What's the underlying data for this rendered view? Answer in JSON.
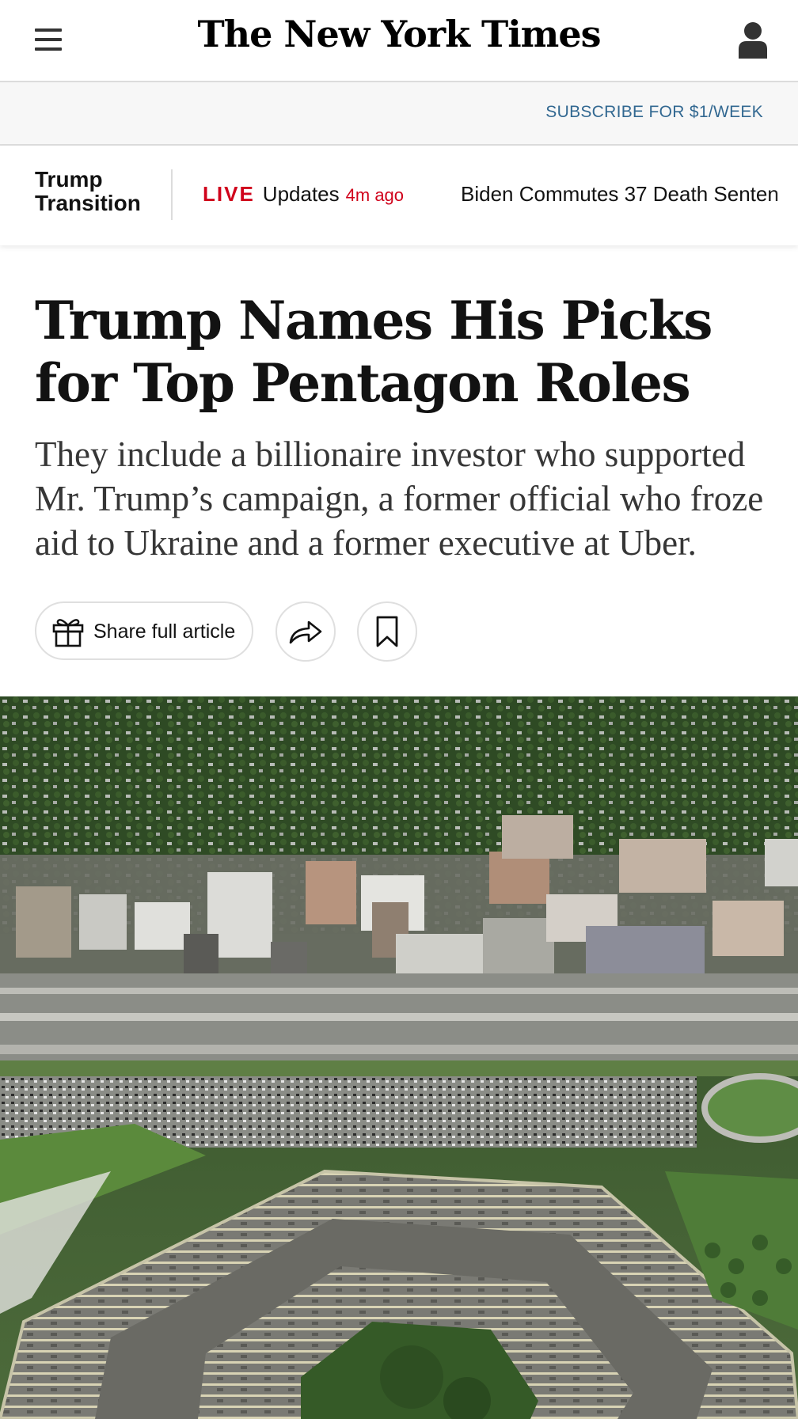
{
  "header": {
    "logo": "The New York Times",
    "menu_icon": "hamburger-menu-icon",
    "account_icon": "user-account-icon"
  },
  "subscribe": {
    "label": "SUBSCRIBE FOR $1/WEEK"
  },
  "topic_bar": {
    "label_line1": "Trump",
    "label_line2": "Transition",
    "live_tag": "LIVE",
    "live_text": "Updates",
    "live_time": "4m ago",
    "next_story": "Biden Commutes 37 Death Senten"
  },
  "article": {
    "headline": "Trump Names His Picks for Top Pentagon Roles",
    "summary": "They include a billionaire investor who supported Mr. Trump’s campaign, a former official who froze aid to Ukraine and a former executive at Uber."
  },
  "actions": {
    "share_label": "Share full article",
    "gift_icon": "gift-icon",
    "forward_icon": "share-arrow-icon",
    "save_icon": "bookmark-icon"
  },
  "colors": {
    "link_blue": "#326891",
    "live_red": "#d0021b",
    "text": "#121212",
    "summary_text": "#363636"
  }
}
